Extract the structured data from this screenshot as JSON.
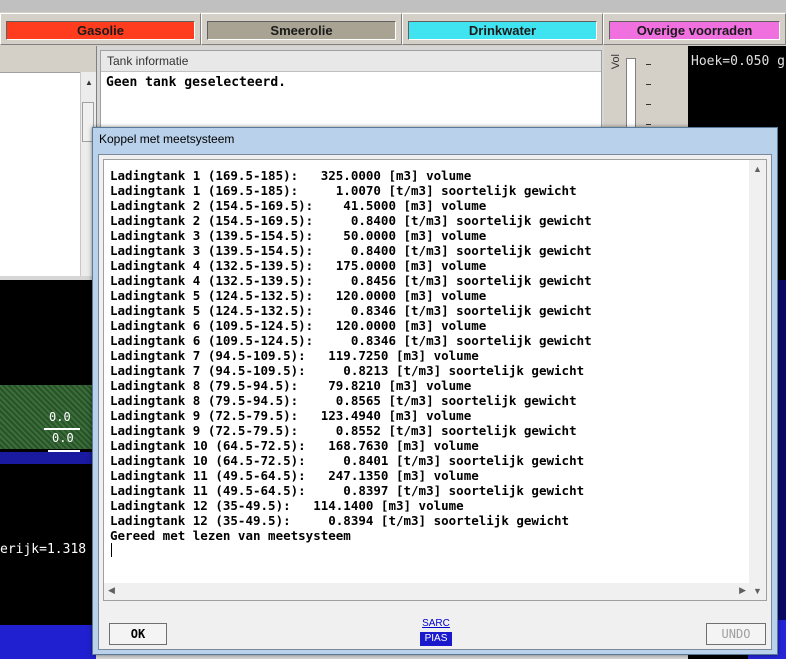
{
  "tabs": [
    {
      "label": "Gasolie",
      "color": "#ff3c1e"
    },
    {
      "label": "Smeerolie",
      "color": "#a9a393"
    },
    {
      "label": "Drinkwater",
      "color": "#40e4f0"
    },
    {
      "label": "Overige voorraden",
      "color": "#f070e0"
    }
  ],
  "tank_panel": {
    "title": "Tank informatie",
    "message": "Geen tank geselecteerd."
  },
  "vol_label": "Vol",
  "hoek_text": "Hoek=0.050 g",
  "left_values": {
    "v1": "0.0",
    "v2": "0.0"
  },
  "ratio_text": "erijk=1.318",
  "dialog": {
    "title": "Koppel met meetsysteem",
    "lines": [
      "Ladingtank 1 (169.5-185):   325.0000 [m3] volume",
      "Ladingtank 1 (169.5-185):     1.0070 [t/m3] soortelijk gewicht",
      "Ladingtank 2 (154.5-169.5):    41.5000 [m3] volume",
      "Ladingtank 2 (154.5-169.5):     0.8400 [t/m3] soortelijk gewicht",
      "Ladingtank 3 (139.5-154.5):    50.0000 [m3] volume",
      "Ladingtank 3 (139.5-154.5):     0.8400 [t/m3] soortelijk gewicht",
      "Ladingtank 4 (132.5-139.5):   175.0000 [m3] volume",
      "Ladingtank 4 (132.5-139.5):     0.8456 [t/m3] soortelijk gewicht",
      "Ladingtank 5 (124.5-132.5):   120.0000 [m3] volume",
      "Ladingtank 5 (124.5-132.5):     0.8346 [t/m3] soortelijk gewicht",
      "Ladingtank 6 (109.5-124.5):   120.0000 [m3] volume",
      "Ladingtank 6 (109.5-124.5):     0.8346 [t/m3] soortelijk gewicht",
      "Ladingtank 7 (94.5-109.5):   119.7250 [m3] volume",
      "Ladingtank 7 (94.5-109.5):     0.8213 [t/m3] soortelijk gewicht",
      "Ladingtank 8 (79.5-94.5):    79.8210 [m3] volume",
      "Ladingtank 8 (79.5-94.5):     0.8565 [t/m3] soortelijk gewicht",
      "Ladingtank 9 (72.5-79.5):   123.4940 [m3] volume",
      "Ladingtank 9 (72.5-79.5):     0.8552 [t/m3] soortelijk gewicht",
      "Ladingtank 10 (64.5-72.5):   168.7630 [m3] volume",
      "Ladingtank 10 (64.5-72.5):     0.8401 [t/m3] soortelijk gewicht",
      "Ladingtank 11 (49.5-64.5):   247.1350 [m3] volume",
      "Ladingtank 11 (49.5-64.5):     0.8397 [t/m3] soortelijk gewicht",
      "Ladingtank 12 (35-49.5):   114.1400 [m3] volume",
      "Ladingtank 12 (35-49.5):     0.8394 [t/m3] soortelijk gewicht",
      "Gereed met lezen van meetsysteem"
    ],
    "ok_label": "OK",
    "undo_label": "UNDO",
    "sarc_label": "SARC",
    "pias_label": "PIAS"
  }
}
